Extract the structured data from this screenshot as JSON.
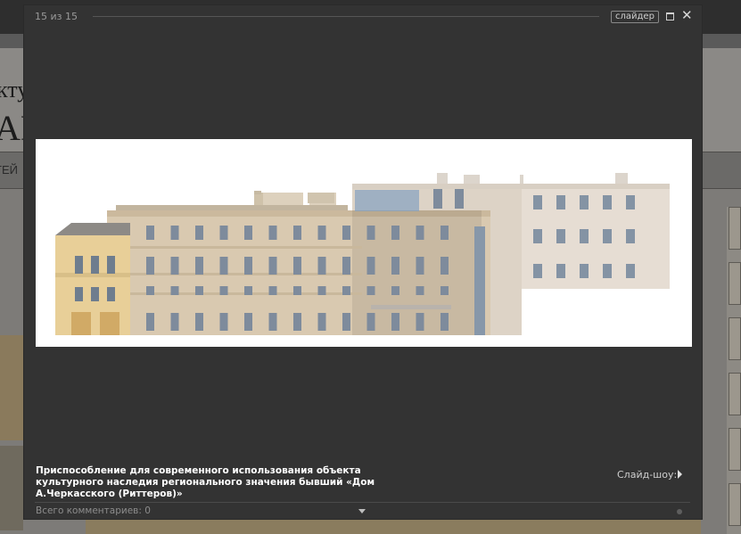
{
  "background": {
    "title_small": "ктур",
    "title_big": "АР",
    "nav_text": "ТЕЙ"
  },
  "lightbox": {
    "counter": "15 из 15",
    "slider_label": "слайдер",
    "maximize_icon": "maximize-icon",
    "close_glyph": "✕",
    "caption": "Приспособление для современного использования объекта культурного наследия регионального значения бывший «Дом А.Черкасского (Риттеров)»",
    "slideshow_label": "Слайд-шоу:",
    "comments_label": "Всего комментариев: 0"
  },
  "colors": {
    "overlay": "#333333",
    "facade_main": "#d9c9b0",
    "facade_yellow": "#e8cf98",
    "facade_right": "#e6ddd3",
    "window": "#7e8b9c"
  }
}
